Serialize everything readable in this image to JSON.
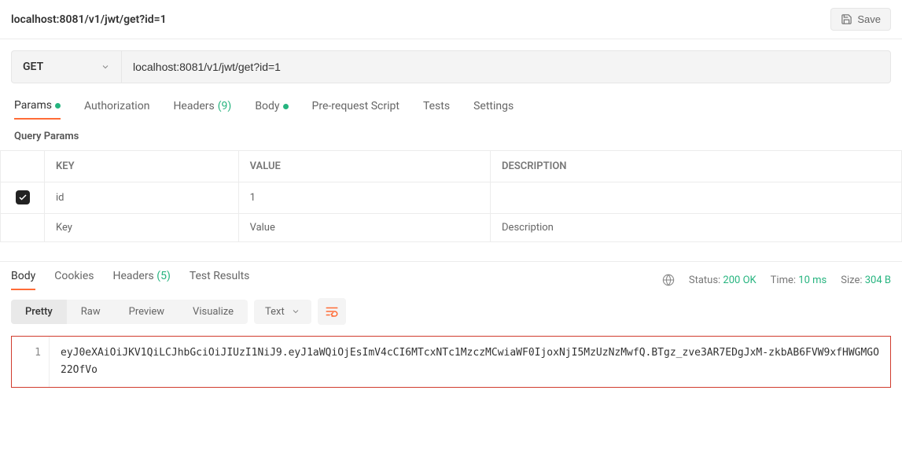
{
  "title": "localhost:8081/v1/jwt/get?id=1",
  "save_label": "Save",
  "method": "GET",
  "url": "localhost:8081/v1/jwt/get?id=1",
  "request_tabs": {
    "params": "Params",
    "authorization": "Authorization",
    "headers": "Headers",
    "headers_count": "(9)",
    "body": "Body",
    "prerequest": "Pre-request Script",
    "tests": "Tests",
    "settings": "Settings"
  },
  "query_params_label": "Query Params",
  "params_headers": {
    "key": "KEY",
    "value": "VALUE",
    "description": "DESCRIPTION"
  },
  "params_rows": [
    {
      "enabled": true,
      "key": "id",
      "value": "1",
      "description": ""
    }
  ],
  "params_placeholders": {
    "key": "Key",
    "value": "Value",
    "description": "Description"
  },
  "response_tabs": {
    "body": "Body",
    "cookies": "Cookies",
    "headers": "Headers",
    "headers_count": "(5)",
    "test_results": "Test Results"
  },
  "response_meta": {
    "status_label": "Status:",
    "status_value": "200 OK",
    "time_label": "Time:",
    "time_value": "10 ms",
    "size_label": "Size:",
    "size_value": "304 B"
  },
  "view_segments": {
    "pretty": "Pretty",
    "raw": "Raw",
    "preview": "Preview",
    "visualize": "Visualize"
  },
  "content_type": "Text",
  "response_body": {
    "line_number": "1",
    "text": "eyJ0eXAiOiJKV1QiLCJhbGciOiJIUzI1NiJ9.eyJ1aWQiOjEsImV4cCI6MTcxNTc1MzczMCwiaWF0IjoxNjI5MzUzNzMwfQ.BTgz_zve3AR7EDgJxM-zkbAB6FVW9xfHWGMGO22OfVo"
  }
}
